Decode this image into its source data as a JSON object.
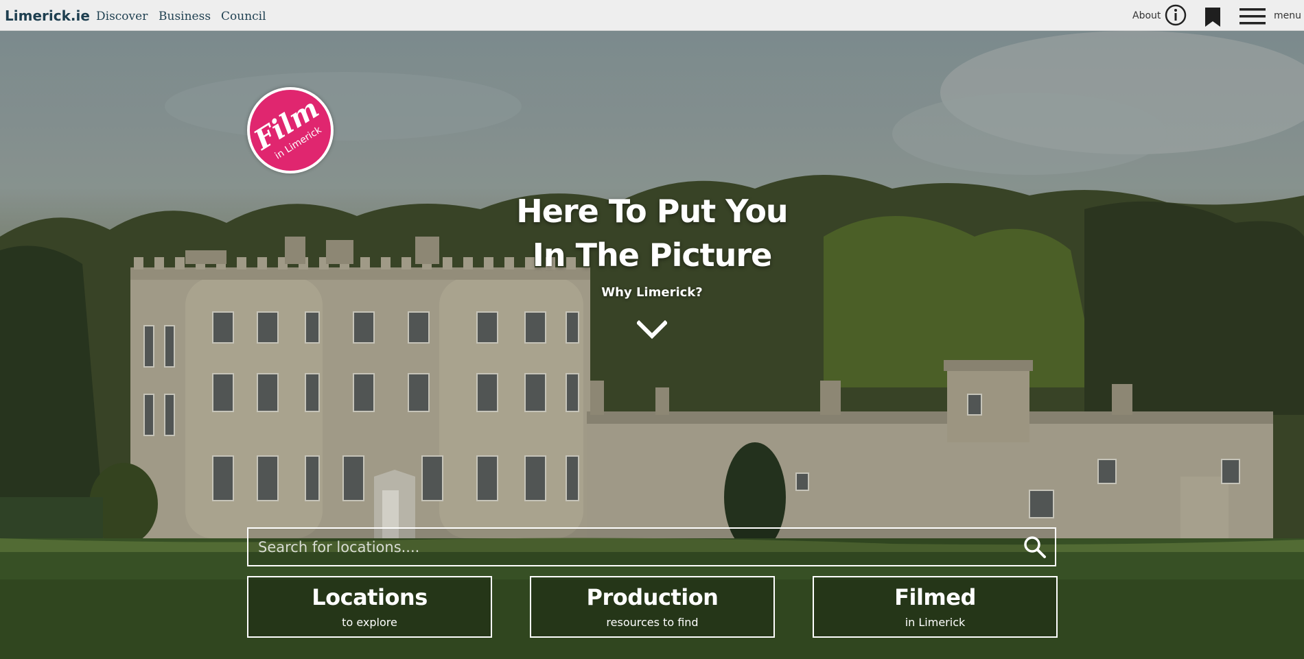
{
  "header": {
    "brand": "Limerick.ie",
    "nav": [
      "Discover",
      "Business",
      "Council"
    ],
    "about_label": "About",
    "menu_label": "menu",
    "icons": [
      "info-icon",
      "bookmark-icon",
      "hamburger-icon"
    ]
  },
  "hero": {
    "logo": {
      "title": "Film",
      "subtitle": "in Limerick",
      "color": "#e0266f"
    },
    "headline_line1": "Here To Put You",
    "headline_line2": "In The Picture",
    "why_link": "Why Limerick?",
    "scroll_icon": "chevron-down-icon"
  },
  "search": {
    "placeholder": "Search for locations....",
    "value": "",
    "icon": "search-icon"
  },
  "categories": [
    {
      "title": "Locations",
      "subtitle": "to explore"
    },
    {
      "title": "Production",
      "subtitle": "resources to find"
    },
    {
      "title": "Filmed",
      "subtitle": "in Limerick"
    }
  ]
}
